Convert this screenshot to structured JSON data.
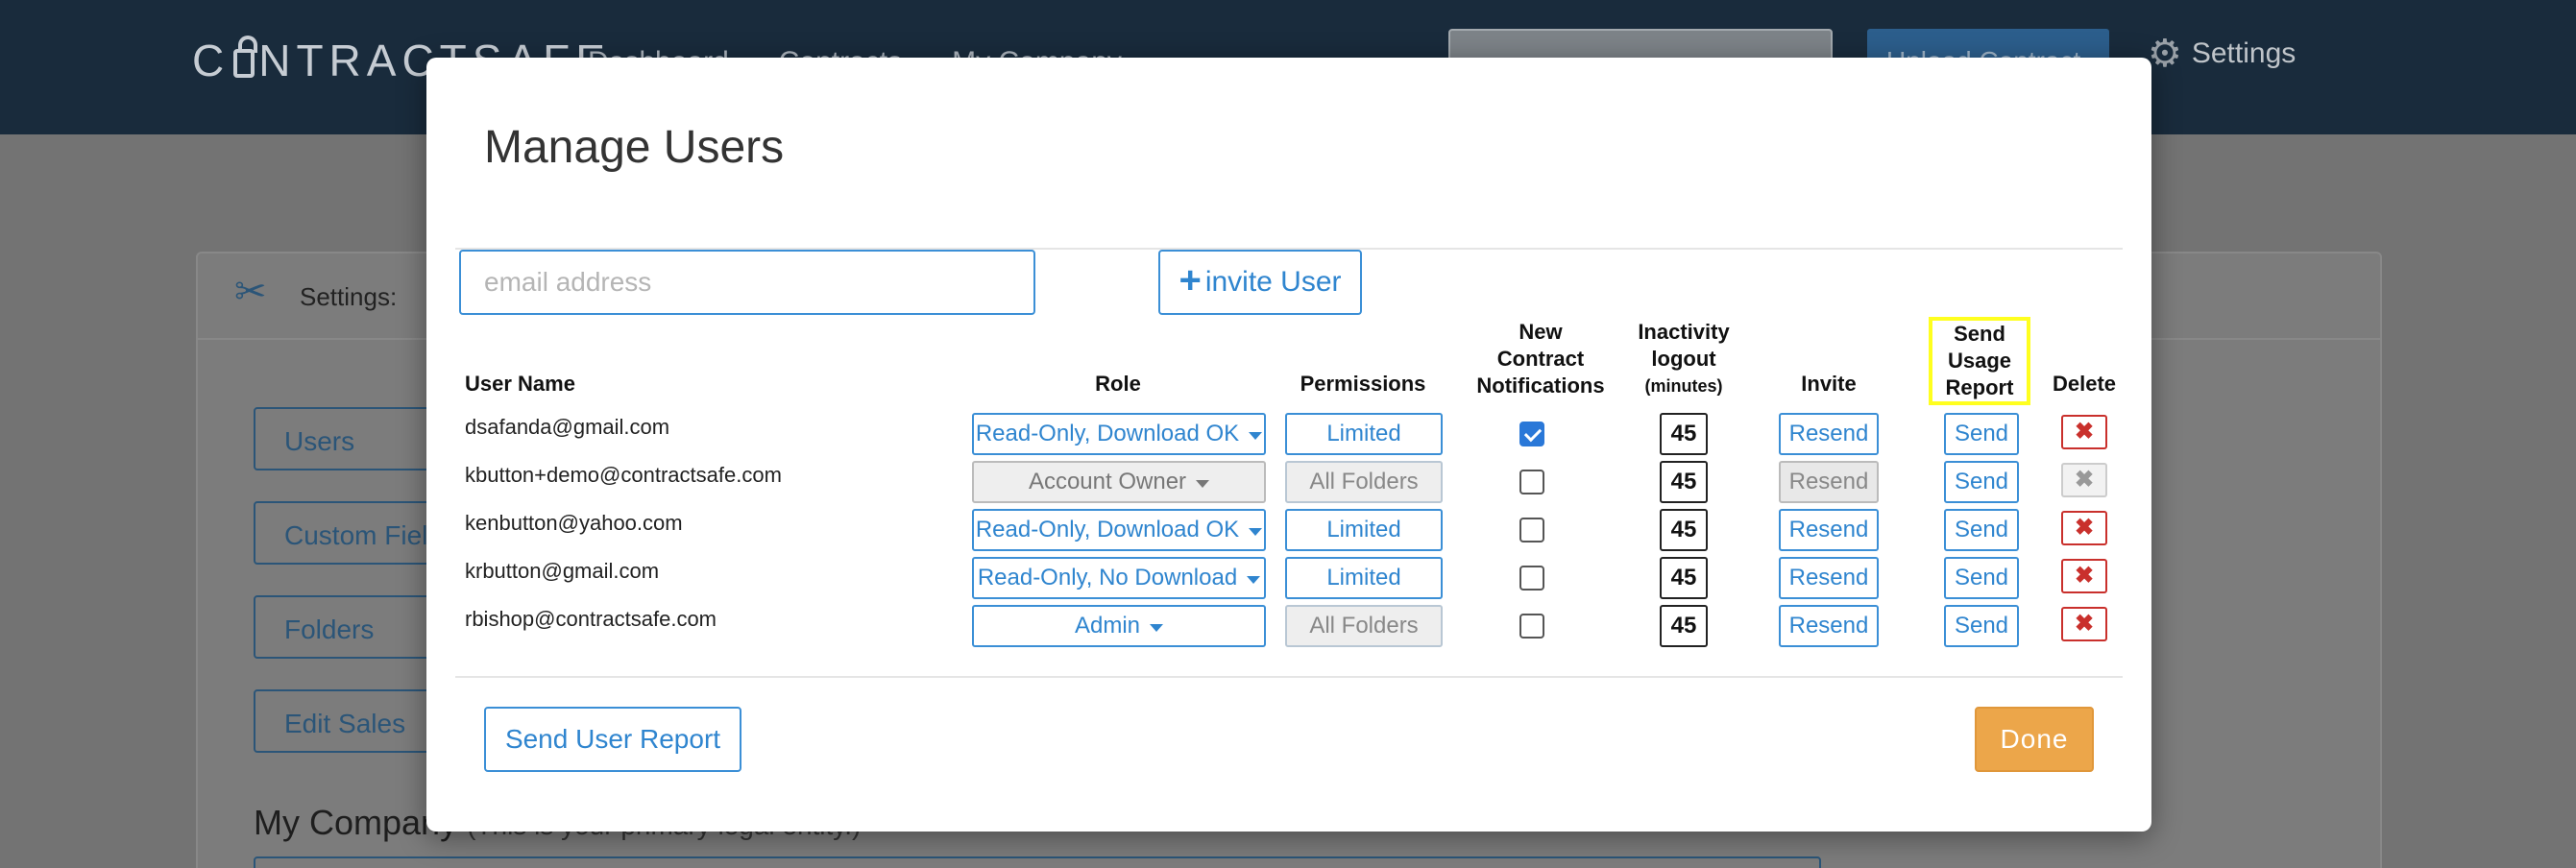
{
  "app": {
    "logo": "CONTRACTSAFE",
    "nav": [
      "Dashboard",
      "Contracts",
      "My Company"
    ],
    "settings_label": "Settings",
    "upload_label": "Upload Contract",
    "background": {
      "panel_title": "Settings:",
      "buttons": [
        "Users",
        "Custom Fields",
        "Folders",
        "Edit Sales"
      ],
      "my_company": "My Company",
      "my_company_note": "(This is your primary legal entity.)"
    }
  },
  "modal": {
    "title": "Manage Users",
    "email_placeholder": "email address",
    "invite_label": "invite User",
    "headers": {
      "user_name": "User Name",
      "role": "Role",
      "permissions": "Permissions",
      "notifications_1": "New",
      "notifications_2": "Contract",
      "notifications_3": "Notifications",
      "logout_1": "Inactivity",
      "logout_2": "logout",
      "logout_3": "(minutes)",
      "invite": "Invite",
      "usage_1": "Send",
      "usage_2": "Usage",
      "usage_3": "Report",
      "delete": "Delete"
    },
    "users": [
      {
        "email": "dsafanda@gmail.com",
        "role": "Read-Only, Download OK",
        "permissions": "Limited",
        "notifications": true,
        "logout": "45",
        "invite": "Resend",
        "send": "Send"
      },
      {
        "email": "kbutton+demo@contractsafe.com",
        "role": "Account Owner",
        "permissions": "All Folders",
        "notifications": false,
        "logout": "45",
        "invite": "Resend",
        "send": "Send"
      },
      {
        "email": "kenbutton@yahoo.com",
        "role": "Read-Only, Download OK",
        "permissions": "Limited",
        "notifications": false,
        "logout": "45",
        "invite": "Resend",
        "send": "Send"
      },
      {
        "email": "krbutton@gmail.com",
        "role": "Read-Only, No Download",
        "permissions": "Limited",
        "notifications": false,
        "logout": "45",
        "invite": "Resend",
        "send": "Send"
      },
      {
        "email": "rbishop@contractsafe.com",
        "role": "Admin",
        "permissions": "All Folders",
        "notifications": false,
        "logout": "45",
        "invite": "Resend",
        "send": "Send"
      }
    ],
    "send_report_label": "Send User Report",
    "done_label": "Done"
  },
  "colors": {
    "accent": "#2f85cf",
    "danger": "#c9302c",
    "done": "#eca64a",
    "highlight": "#ffff1f"
  }
}
